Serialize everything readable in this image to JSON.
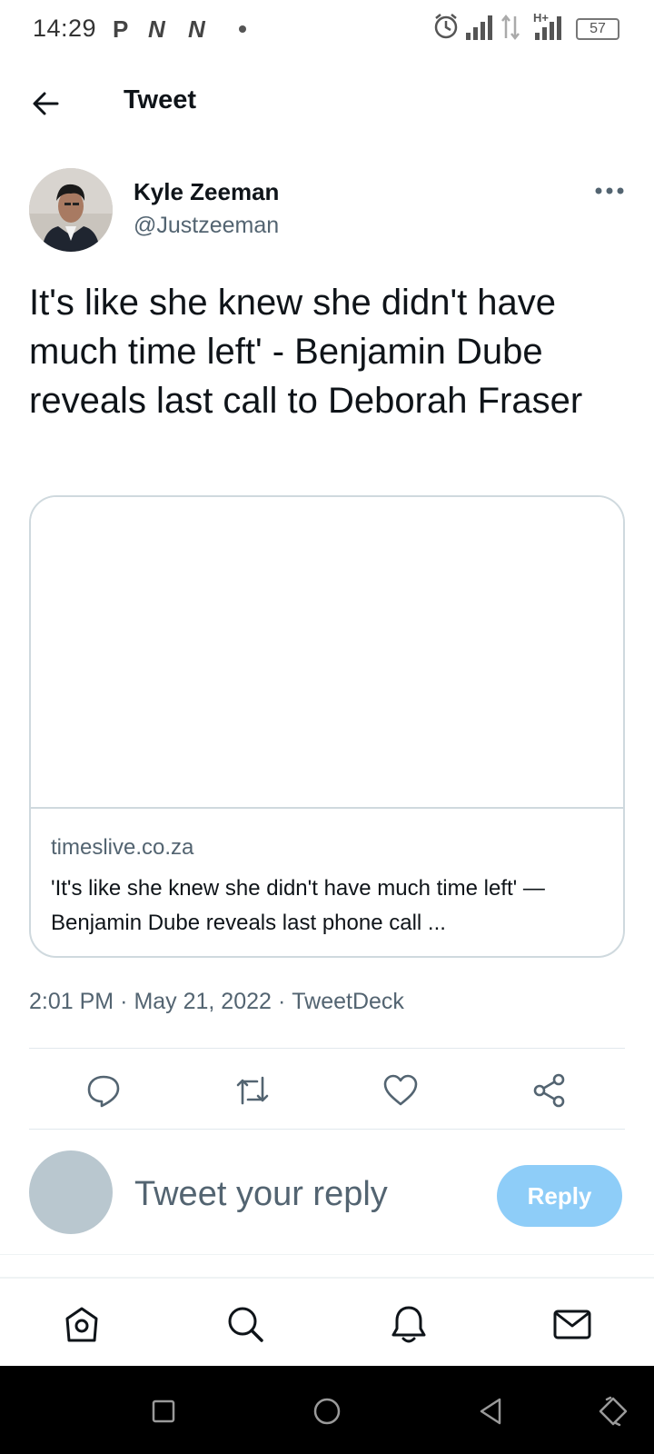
{
  "status_bar": {
    "time": "14:29",
    "notif_p": "P",
    "notif_n1": "N",
    "notif_n2": "N",
    "network_label": "H+",
    "battery": "57"
  },
  "header": {
    "title": "Tweet",
    "back_icon": "arrow-left-icon"
  },
  "tweet": {
    "author_name": "Kyle Zeeman",
    "author_handle": "@Justzeeman",
    "text": "It's like she knew she didn't have much time left' - Benjamin Dube reveals last call to Deborah Fraser",
    "card": {
      "domain": "timeslive.co.za",
      "title": "'It's like she knew she didn't have much time left' — Benjamin Dube reveals last phone call ..."
    },
    "meta": {
      "time": "2:01 PM",
      "date": "May 21, 2022",
      "client": "TweetDeck",
      "separator": "·"
    },
    "actions": [
      "reply-icon",
      "retweet-icon",
      "like-icon",
      "share-icon"
    ]
  },
  "reply": {
    "placeholder": "Tweet your reply",
    "button_label": "Reply"
  },
  "bottom_nav": [
    "home-icon",
    "search-icon",
    "notifications-icon",
    "messages-icon"
  ],
  "colors": {
    "text_primary": "#0f1419",
    "text_secondary": "#536471",
    "reply_button_disabled": "#8ecdf8",
    "border": "#cfd9de"
  }
}
